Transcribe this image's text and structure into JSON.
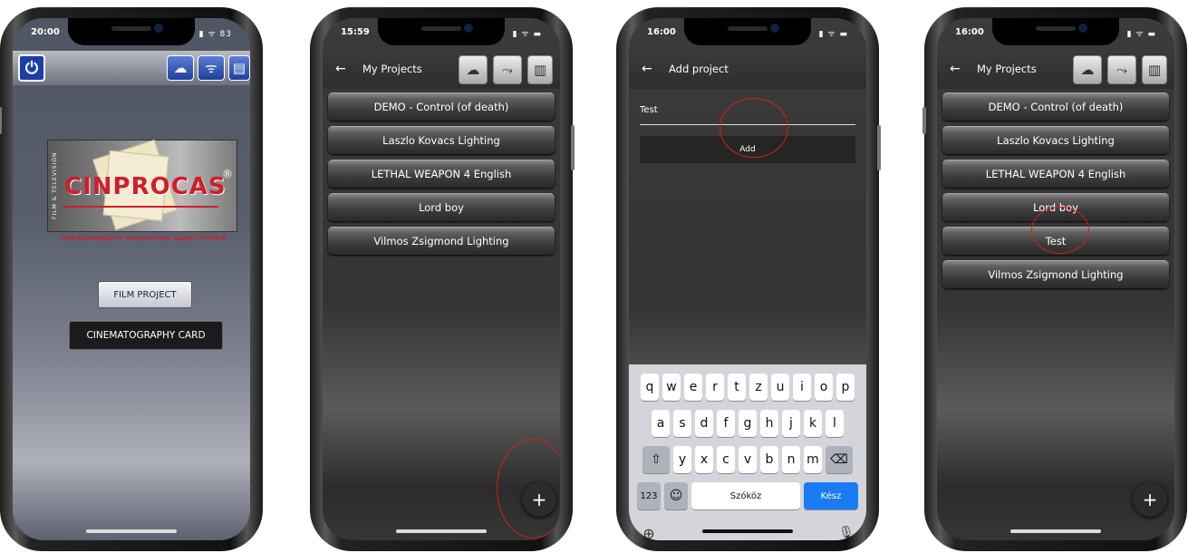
{
  "screens": [
    {
      "status": {
        "time": "20:00",
        "icons": "▮ ᯤ 83"
      },
      "logo": {
        "wordmark": "CINPROCAS",
        "vertical_text": "FILM & TELEVISION",
        "registered": "®",
        "subtitle": "CINEMATOGRAPHY PRODUCTION CARDS SYSTEM"
      },
      "buttons": {
        "film_project": "FILM PROJECT",
        "cinematography_card": "CINEMATOGRAPHY CARD"
      }
    },
    {
      "status": {
        "time": "15:59",
        "icons": "▮ ᯤ ▬"
      },
      "nav": {
        "back": "←",
        "title": "My Projects"
      },
      "projects": [
        "DEMO - Control (of death)",
        "Laszlo Kovacs Lighting",
        "LETHAL WEAPON 4 English",
        "Lord boy",
        "Vilmos Zsigmond Lighting"
      ],
      "fab": "+"
    },
    {
      "status": {
        "time": "16:00",
        "icons": "▮ ᯤ ▬"
      },
      "nav": {
        "back": "←",
        "title": "Add project"
      },
      "input_value": "Test",
      "add_label": "Add",
      "keyboard": {
        "row1": [
          "q",
          "w",
          "e",
          "r",
          "t",
          "z",
          "u",
          "i",
          "o",
          "p"
        ],
        "row2": [
          "a",
          "s",
          "d",
          "f",
          "g",
          "h",
          "j",
          "k",
          "l"
        ],
        "row3": [
          "y",
          "x",
          "c",
          "v",
          "b",
          "n",
          "m"
        ],
        "shift": "⇧",
        "backspace": "⌫",
        "numbers": "123",
        "emoji": "☺",
        "space": "Szóköz",
        "done": "Kész",
        "globe": "⊕",
        "mic": "🎙"
      }
    },
    {
      "status": {
        "time": "16:00",
        "icons": "▮ ᯤ ▬"
      },
      "nav": {
        "back": "←",
        "title": "My Projects"
      },
      "projects": [
        "DEMO - Control (of death)",
        "Laszlo Kovacs Lighting",
        "LETHAL WEAPON 4 English",
        "Lord boy",
        "Test",
        "Vilmos Zsigmond Lighting"
      ],
      "fab": "+"
    }
  ],
  "icons": {
    "power": "⏻",
    "cloud_sync": "☁",
    "wifi": "ᯤ",
    "clapper": "▤",
    "route": "⤳",
    "film_strip": "▥"
  },
  "colors": {
    "annotation_red": "#d31f1f",
    "brand_red": "#d11e2a",
    "ios_blue": "#1a7cf5",
    "power_blue": "#1c3ea8"
  }
}
